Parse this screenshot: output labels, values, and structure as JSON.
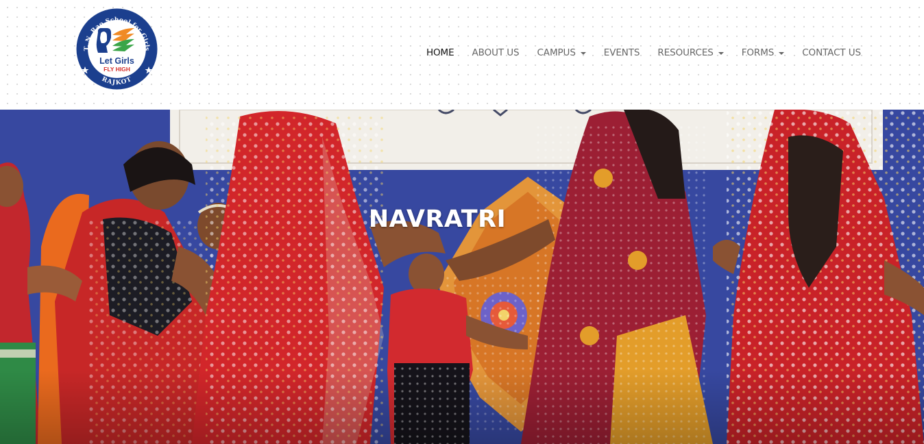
{
  "logo": {
    "arc_text_top": "T. N. Rao School for Girls",
    "tagline_line1": "Let Girls",
    "tagline_line2": "FLY HIGH",
    "arc_text_bottom": "RAJKOT"
  },
  "nav": {
    "items": [
      {
        "label": "HOME",
        "active": true,
        "dropdown": false
      },
      {
        "label": "ABOUT US",
        "active": false,
        "dropdown": false
      },
      {
        "label": "CAMPUS",
        "active": false,
        "dropdown": true
      },
      {
        "label": "EVENTS",
        "active": false,
        "dropdown": false
      },
      {
        "label": "RESOURCES",
        "active": false,
        "dropdown": true
      },
      {
        "label": "FORMS",
        "active": false,
        "dropdown": true
      },
      {
        "label": "CONTACT US",
        "active": false,
        "dropdown": false
      }
    ]
  },
  "hero": {
    "title": "NAVRATRI"
  },
  "colors": {
    "logo_blue": "#1b3f8e",
    "logo_orange": "#f08a24",
    "logo_green": "#3aa548",
    "logo_red": "#d6302b",
    "nav_text": "#666666",
    "nav_active": "#111111",
    "hero_backdrop_blue": "#3c4ea6",
    "hero_title": "#ffffff"
  }
}
